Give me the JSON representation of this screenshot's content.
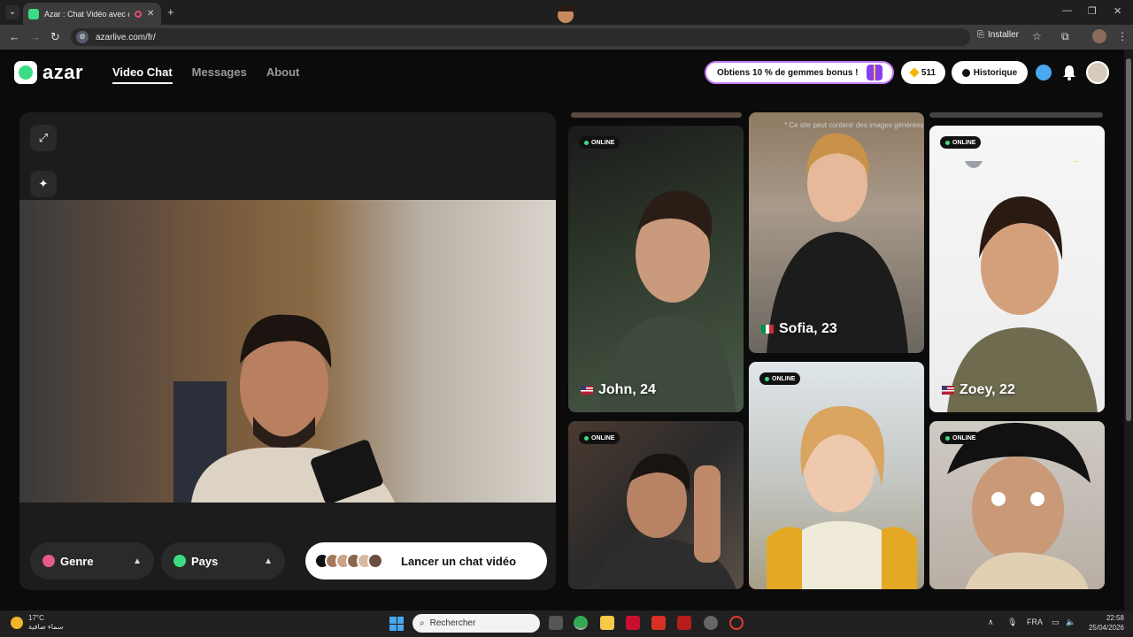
{
  "browser": {
    "tab_title": "Azar : Chat Vidéo avec de n",
    "url": "azarlive.com/fr/",
    "install_label": "Installer"
  },
  "header": {
    "logo_text": "azar",
    "nav": [
      {
        "label": "Video Chat",
        "active": true
      },
      {
        "label": "Messages",
        "active": false
      },
      {
        "label": "About",
        "active": false
      }
    ],
    "promo_text": "Obtiens 10 % de gemmes bonus !",
    "gem_count": "511",
    "history_label": "Historique"
  },
  "video_panel": {
    "filters": [
      {
        "label": "Genre",
        "icon": "gender-icon",
        "color": "#e55b8a"
      },
      {
        "label": "Pays",
        "icon": "globe-icon",
        "color": "#3ddc84"
      }
    ],
    "launch_label": "Lancer un chat vidéo"
  },
  "cards": {
    "online_label": "ONLINE",
    "disclaimer": "* Ce site peut contenir des images générées par IA : les personnes représentées sont des modèles et sont utilisées à des fins d'illustration uniquement.",
    "people": [
      {
        "name": "John, 24",
        "flag": "us"
      },
      {
        "name": "Sofia, 23",
        "flag": "it"
      },
      {
        "name": "Zoey, 22",
        "flag": "us"
      }
    ]
  },
  "taskbar": {
    "temperature": "17°C",
    "weather_desc": "سماء صافية",
    "search_placeholder": "Rechercher",
    "language": "FRA",
    "time": "22:58",
    "date": "25/04/2026"
  },
  "colors": {
    "accent_green": "#3ddc84",
    "promo_border": "#c47df7",
    "gem": "#f7b500"
  }
}
